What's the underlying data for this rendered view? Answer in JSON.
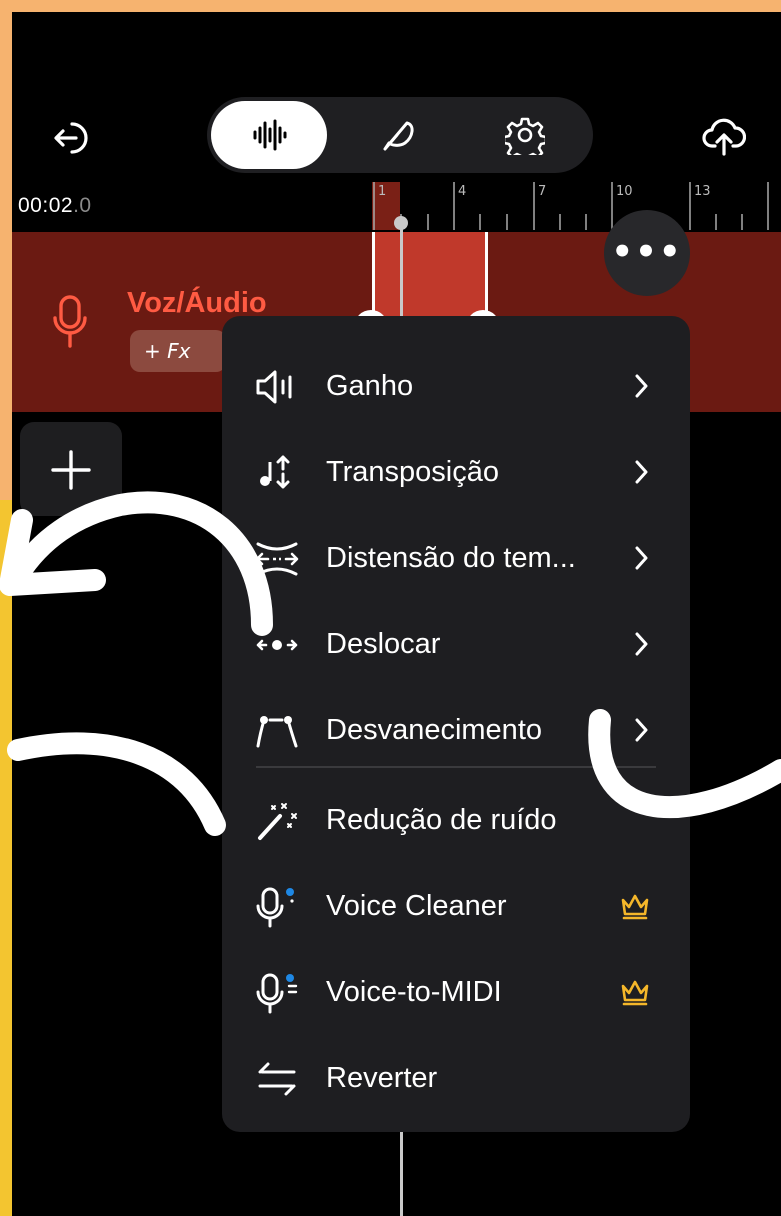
{
  "timeline": {
    "timecode_main": "00:02",
    "timecode_fraction": ".0",
    "ruler_marks": [
      "1",
      "4",
      "7",
      "10",
      "13"
    ]
  },
  "track": {
    "name": "Voz/Áudio",
    "fx_label": "+ Fx"
  },
  "toolbar": {
    "tabs": [
      {
        "icon": "waveform-icon",
        "active": true
      },
      {
        "icon": "quill-icon",
        "active": false
      },
      {
        "icon": "gear-icon",
        "active": false
      }
    ]
  },
  "menu": {
    "items": [
      {
        "label": "Ganho",
        "icon": "volume-icon",
        "submenu": true
      },
      {
        "label": "Transposição",
        "icon": "transpose-icon",
        "submenu": true
      },
      {
        "label": "Distensão do tem...",
        "icon": "time-stretch-icon",
        "submenu": true
      },
      {
        "label": "Deslocar",
        "icon": "shift-icon",
        "submenu": true
      },
      {
        "label": "Desvanecimento",
        "icon": "fade-icon",
        "submenu": true
      },
      {
        "label": "Redução de ruído",
        "icon": "magic-wand-icon",
        "submenu": false
      },
      {
        "label": "Voice Cleaner",
        "icon": "voice-cleaner-icon",
        "premium": true
      },
      {
        "label": "Voice-to-MIDI",
        "icon": "voice-to-midi-icon",
        "premium": true
      },
      {
        "label": "Reverter",
        "icon": "reverse-icon",
        "submenu": false
      }
    ]
  },
  "colors": {
    "accent_red": "#ff5b43",
    "track_bg": "#6b1a12",
    "crown": "#f5b72a",
    "frame_orange": "#f6b36f",
    "frame_yellow": "#f3c530"
  }
}
